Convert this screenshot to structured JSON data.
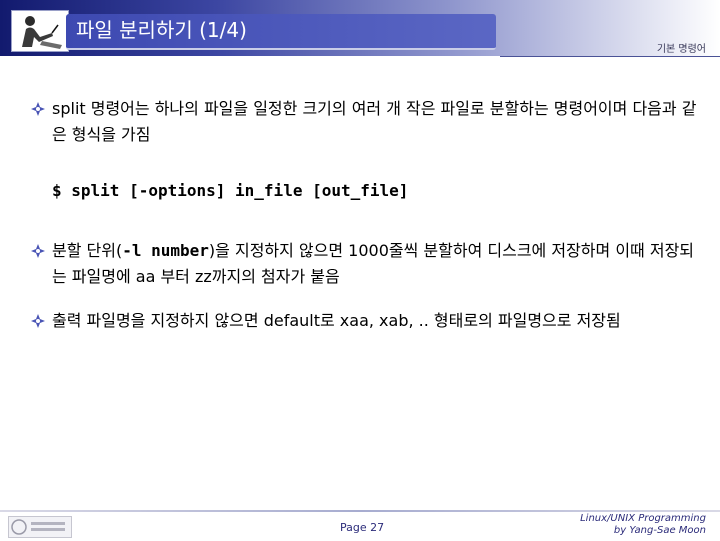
{
  "header": {
    "title": "파일 분리하기 (1/4)",
    "section_tag": "기본 명령어"
  },
  "content": {
    "bullet1": "split 명령어는 하나의 파일을 일정한 크기의 여러 개 작은 파일로 분할하는 명령어이며 다음과 같은 형식을 가짐",
    "command": "$ split [-options] in_file [out_file]",
    "bullet2_pre": "분할 단위(",
    "bullet2_code": "-l number",
    "bullet2_post": ")을 지정하지 않으면 1000줄씩 분할하여 디스크에 저장하며 이때 저장되는 파일명에 aa 부터 zz까지의 첨자가 붙음",
    "bullet3": "출력 파일명을 지정하지 않으면 default로 xaa, xab, .. 형태로의 파일명으로 저장됨"
  },
  "footer": {
    "page": "Page 27",
    "credit_line1": "Linux/UNIX Programming",
    "credit_line2": "by Yang-Sae Moon"
  },
  "colors": {
    "title_bar_dark": "#121a6e",
    "title_pill": "#3d49b1",
    "footer_text": "#2c2c7a"
  }
}
